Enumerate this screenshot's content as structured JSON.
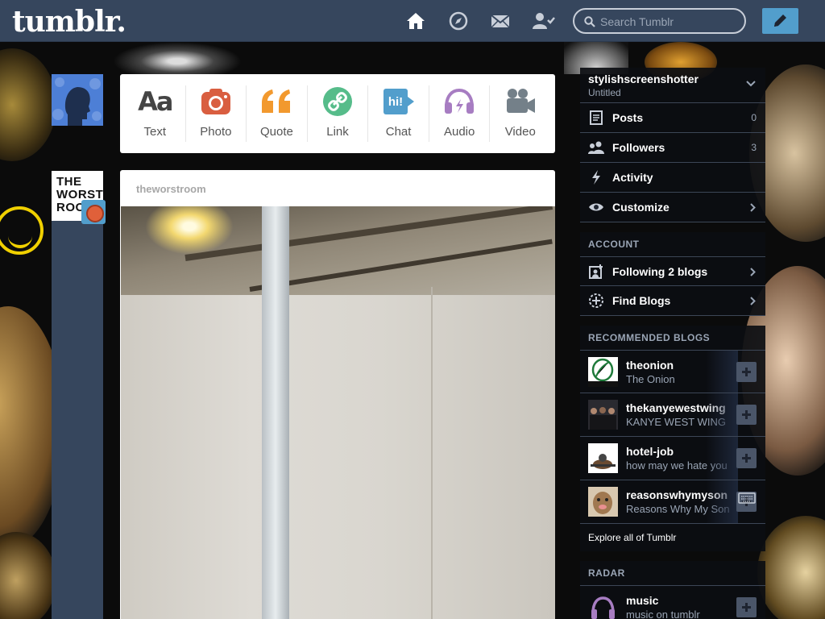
{
  "header": {
    "logo": "tumblr.",
    "search_placeholder": "Search Tumblr",
    "icons": [
      "home-icon",
      "explore-compass-icon",
      "inbox-mail-icon",
      "account-person-icon",
      "compose-pencil-icon"
    ]
  },
  "post_types": [
    {
      "label": "Text",
      "icon": "text-icon",
      "color": "#444444"
    },
    {
      "label": "Photo",
      "icon": "camera-icon",
      "color": "#d95e40"
    },
    {
      "label": "Quote",
      "icon": "quote-icon",
      "color": "#f2992e"
    },
    {
      "label": "Link",
      "icon": "link-icon",
      "color": "#56bc8a"
    },
    {
      "label": "Chat",
      "icon": "chat-icon",
      "color": "#529ecc"
    },
    {
      "label": "Audio",
      "icon": "headphones-icon",
      "color": "#a77dc2"
    },
    {
      "label": "Video",
      "icon": "video-camera-icon",
      "color": "#748089"
    }
  ],
  "post": {
    "blog_name": "theworstroom",
    "avatar_text": [
      "THE",
      "WORST",
      "ROO"
    ]
  },
  "sidebar": {
    "blog_name": "stylishscreenshotter",
    "blog_title": "Untitled",
    "items": [
      {
        "label": "Posts",
        "count": "0",
        "icon": "posts-icon"
      },
      {
        "label": "Followers",
        "count": "3",
        "icon": "followers-icon"
      },
      {
        "label": "Activity",
        "count": "",
        "icon": "activity-bolt-icon"
      },
      {
        "label": "Customize",
        "count": "",
        "icon": "eye-icon"
      }
    ],
    "account_title": "ACCOUNT",
    "account_items": [
      {
        "label": "Following 2 blogs",
        "icon": "following-icon"
      },
      {
        "label": "Find Blogs",
        "icon": "find-blogs-icon"
      }
    ],
    "recommended_title": "RECOMMENDED BLOGS",
    "recommended": [
      {
        "name": "theonion",
        "title": "The Onion"
      },
      {
        "name": "thekanyewestwing",
        "title": "KANYE WEST WING"
      },
      {
        "name": "hotel-job",
        "title": "how may we hate you"
      },
      {
        "name": "reasonswhymyson",
        "title": "Reasons Why My Son"
      }
    ],
    "explore_label": "Explore all of Tumblr",
    "radar_title": "RADAR",
    "radar": {
      "name": "music",
      "title": "music on tumblr"
    }
  },
  "colors": {
    "header_bg": "#36465d",
    "accent_blue": "#529ecc",
    "sidebar_text_muted": "#9aa5b5"
  }
}
